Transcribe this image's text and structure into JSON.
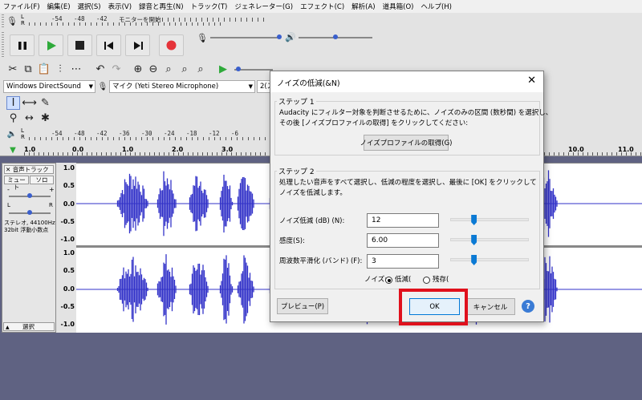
{
  "menu": [
    "ファイル(F)",
    "編集(E)",
    "選択(S)",
    "表示(V)",
    "録音と再生(N)",
    "トラック(T)",
    "ジェネレーター(G)",
    "エフェクト(C)",
    "解析(A)",
    "道具箱(O)",
    "ヘルプ(H)"
  ],
  "meter": {
    "top_labels": [
      "-54",
      "-48",
      "-42",
      "-36",
      "-30",
      "-24",
      "-18",
      "-12",
      "-6",
      "0"
    ],
    "monitor_label": "モニターを開始",
    "bottom_labels": [
      "-54",
      "-48",
      "-42",
      "-36",
      "-30",
      "-24",
      "-18",
      "-12",
      "-6",
      "0"
    ],
    "lr": [
      "L",
      "R"
    ]
  },
  "device": {
    "host": "Windows DirectSound",
    "input": "マイク (Yeti Stereo Microphone)",
    "channels": "2(ス"
  },
  "ruler": {
    "labels": [
      "1.0",
      "0.0",
      "1.0",
      "2.0",
      "3.0",
      "10.0",
      "11.0",
      "12.0"
    ]
  },
  "track": {
    "name": "音声トラック",
    "mute": "ミュート",
    "solo": "ソロ",
    "minus": "-",
    "plus": "+",
    "pan_l": "L",
    "pan_r": "R",
    "info": "ステレオ, 44100Hz\n32bit 浮動小数点",
    "select": "選択",
    "scale": [
      "1.0",
      "0.5",
      "0.0",
      "-0.5",
      "-1.0",
      "1.0",
      "0.5",
      "0.0",
      "-0.5",
      "-1.0"
    ],
    "wave_color": "#3232c8"
  },
  "dialog": {
    "title": "ノイズの低減(&N)",
    "close": "✕",
    "step1_label": "ステップ 1",
    "step1_text": "Audacity にフィルター対象を判断させるために、ノイズのみの区間 (数秒間) を選択し、\nその後 [ノイズプロファイルの取得] をクリックしてください:",
    "profile_button": "ノイズプロファイルの取得(G)",
    "step2_label": "ステップ 2",
    "step2_text": "処理したい音声をすべて選択し、低減の程度を選択し、最後に [OK] をクリックして\nノイズを低減します。",
    "fields": [
      {
        "label": "ノイズ低減 (dB) (N):",
        "value": "12",
        "level": 0.28
      },
      {
        "label": "感度(S):",
        "value": "6.00",
        "level": 0.28
      },
      {
        "label": "周波数平滑化 (バンド) (F):",
        "value": "3",
        "level": 0.28
      }
    ],
    "noise_label": "ノイズ:",
    "radio_reduce": "低減(",
    "radio_residue": "残存(",
    "preview_button": "プレビュー(P)",
    "ok_button": "OK",
    "cancel_button": "キャンセル",
    "help_button": "?",
    "accent": "#e0101c"
  }
}
